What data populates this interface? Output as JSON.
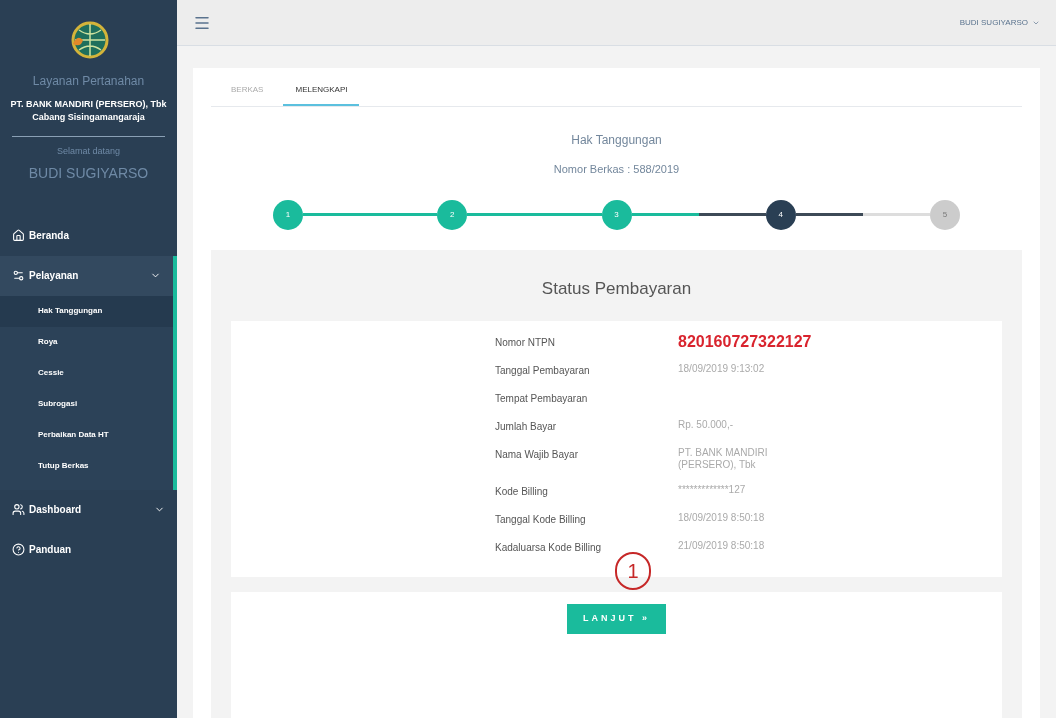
{
  "sidebar": {
    "app_title": "Layanan Pertanahan",
    "office": "PT. BANK MANDIRI (PERSERO), Tbk Cabang Sisingamangaraja",
    "greeting": "Selamat datang",
    "user": "BUDI SUGIYARSO",
    "items": [
      {
        "label": "Beranda",
        "expanded": false,
        "has_children": false
      },
      {
        "label": "Pelayanan",
        "expanded": true,
        "has_children": true,
        "children": [
          {
            "label": "Hak Tanggungan",
            "selected": true
          },
          {
            "label": "Roya",
            "selected": false
          },
          {
            "label": "Cessie",
            "selected": false
          },
          {
            "label": "Subrogasi",
            "selected": false
          },
          {
            "label": "Perbaikan Data HT",
            "selected": false
          },
          {
            "label": "Tutup Berkas",
            "selected": false
          }
        ]
      },
      {
        "label": "Dashboard",
        "expanded": false,
        "has_children": true
      },
      {
        "label": "Panduan",
        "expanded": false,
        "has_children": false
      }
    ]
  },
  "topbar": {
    "user": "BUDI SUGIYARSO"
  },
  "tabs": [
    {
      "label": "BERKAS",
      "selected": false
    },
    {
      "label": "MELENGKAPI",
      "selected": true
    }
  ],
  "title": "Hak Tanggungan",
  "file_number": "Nomor Berkas : 588/2019",
  "steps": [
    {
      "label": "1",
      "kind": "done"
    },
    {
      "label": "2",
      "kind": "done"
    },
    {
      "label": "3",
      "kind": "done"
    },
    {
      "label": "4",
      "kind": "current"
    },
    {
      "label": "5",
      "kind": "todo"
    }
  ],
  "panel_title": "Status Pembayaran",
  "details": [
    {
      "label": "Nomor NTPN",
      "value": "820160727322127",
      "highlight": true
    },
    {
      "label": "Tanggal Pembayaran",
      "value": "18/09/2019 9:13:02",
      "highlight": false
    },
    {
      "label": "Tempat Pembayaran"
    },
    {
      "label": "Jumlah Bayar",
      "value": "Rp. 50.000,-",
      "highlight": false
    },
    {
      "label": "Nama Wajib Bayar",
      "value": "PT. BANK MANDIRI (PERSERO), Tbk",
      "highlight": false
    },
    {
      "label": "Kode Billing",
      "value": "*************127",
      "highlight": false
    },
    {
      "label": "Tanggal Kode Billing",
      "value": "18/09/2019 8:50:18",
      "highlight": false
    },
    {
      "label": "Kadaluarsa Kode Billing",
      "value": "21/09/2019 8:50:18",
      "highlight": false
    }
  ],
  "annotation": "1",
  "next_button": "LANJUT »"
}
